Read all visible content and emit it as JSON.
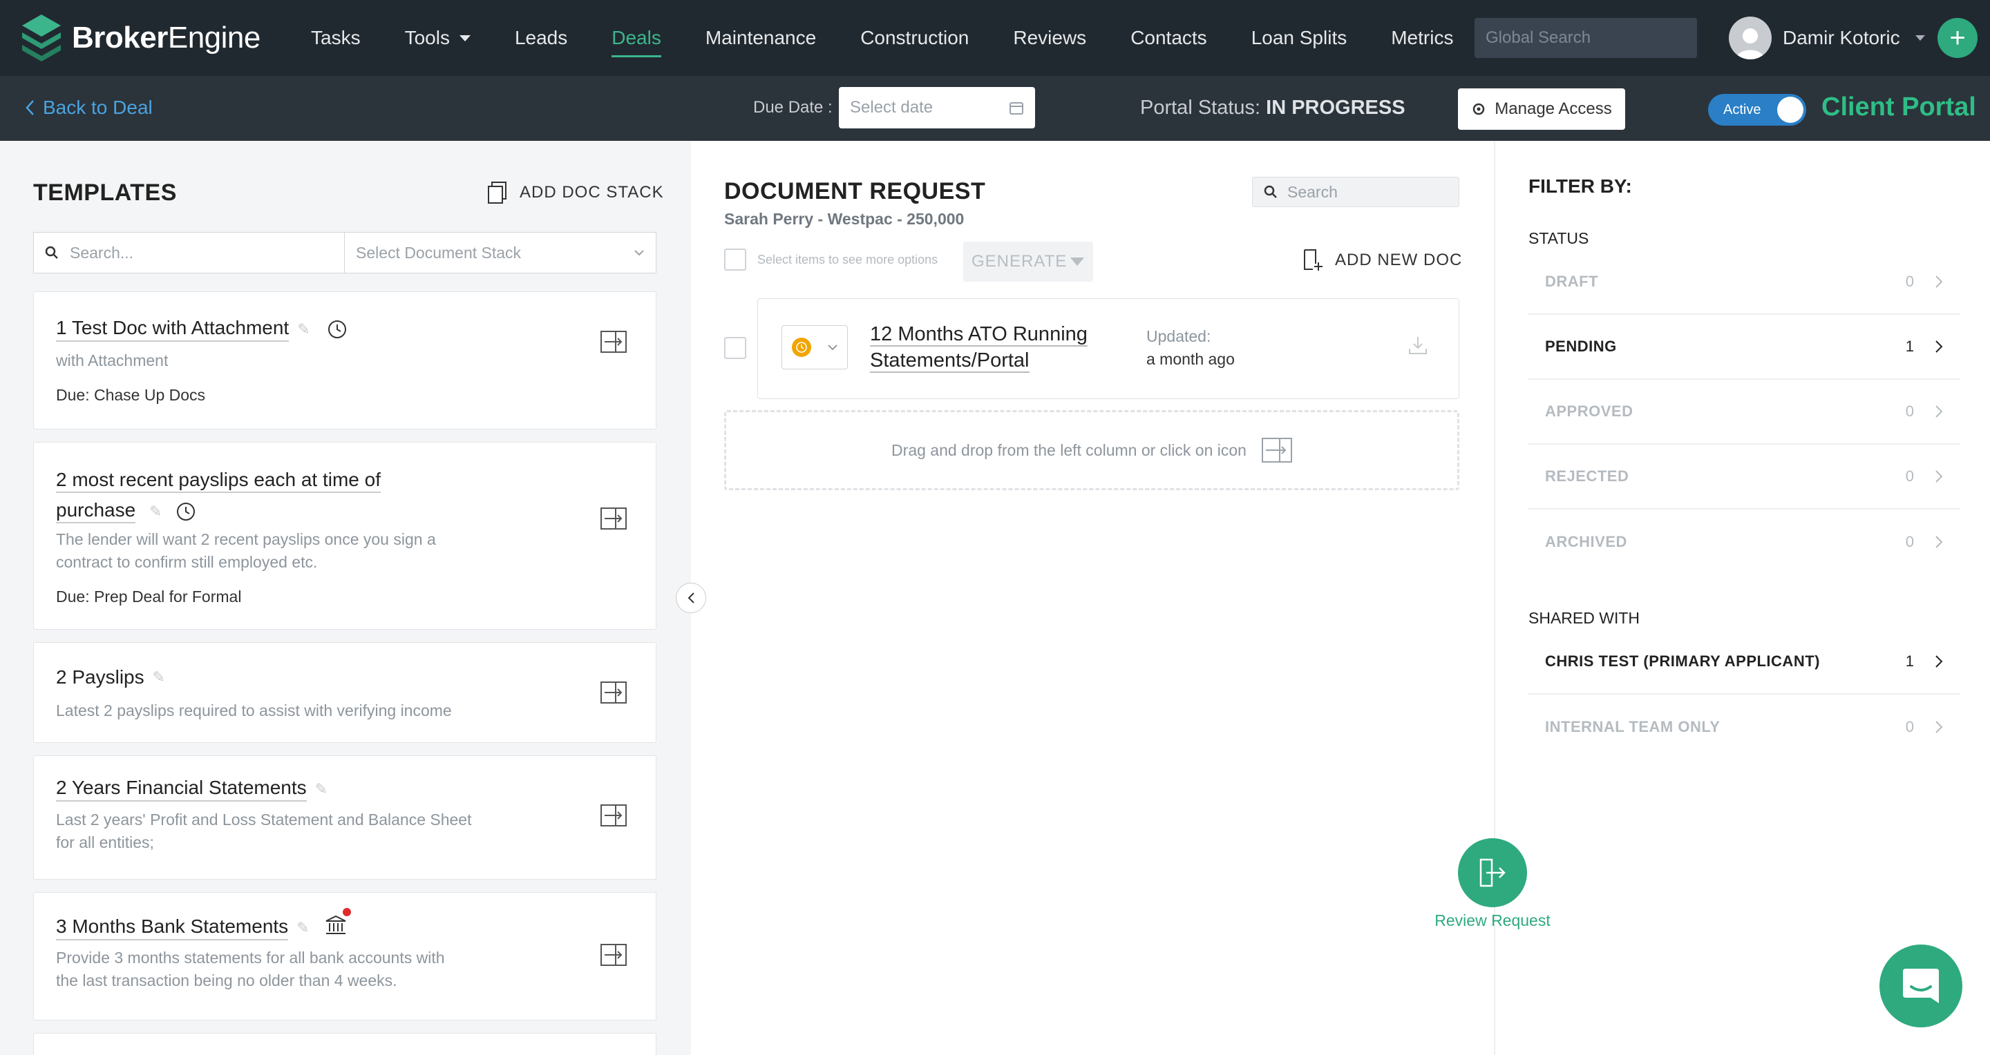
{
  "brand": {
    "name_bold": "Broker",
    "name_rest": "Engine",
    "accent": "#3db58c"
  },
  "nav": {
    "items": [
      {
        "label": "Tasks"
      },
      {
        "label": "Tools"
      },
      {
        "label": "Leads"
      },
      {
        "label": "Deals"
      },
      {
        "label": "Maintenance"
      },
      {
        "label": "Construction"
      },
      {
        "label": "Reviews"
      },
      {
        "label": "Contacts"
      },
      {
        "label": "Loan Splits"
      },
      {
        "label": "Metrics"
      }
    ],
    "active": "Deals",
    "search_placeholder": "Global Search",
    "user_name": "Damir Kotoric"
  },
  "subbar": {
    "back_label": "Back to Deal",
    "due_label": "Due Date :",
    "due_placeholder": "Select date",
    "portal_status_label": "Portal Status:",
    "portal_status_value": "IN PROGRESS",
    "manage_access_label": "Manage Access",
    "toggle_label": "Active",
    "toggle_on": true,
    "client_portal_label": "Client Portal"
  },
  "templates": {
    "title": "TEMPLATES",
    "add_stack_label": "ADD DOC STACK",
    "search_placeholder": "Search...",
    "stack_placeholder": "Select Document Stack",
    "cards": [
      {
        "title": "1 Test Doc with Attachment",
        "sub": "with Attachment",
        "due": "Due: Chase Up Docs"
      },
      {
        "title_line1": "2 most recent payslips each at time of",
        "title_line2": "purchase",
        "desc_line1": "The lender will want 2 recent payslips once you sign a",
        "desc_line2": "contract to confirm still employed etc.",
        "due": "Due: Prep Deal for Formal"
      },
      {
        "title": "2 Payslips",
        "desc_line1": "Latest 2 payslips required to assist with verifying income"
      },
      {
        "title": "2 Years Financial Statements",
        "desc_line1": "Last 2 years' Profit and Loss Statement and Balance Sheet",
        "desc_line2": "for all entities;"
      },
      {
        "title": "3 Months Bank Statements",
        "desc_line1": "Provide 3 months statements for all bank accounts with",
        "desc_line2": "the last transaction being no older than 4 weeks."
      }
    ]
  },
  "request": {
    "title": "DOCUMENT REQUEST",
    "subtitle": "Sarah Perry - Westpac - 250,000",
    "search_placeholder": "Search",
    "select_hint": "Select items to see more options",
    "generate_label": "GENERATE",
    "add_new_label": "ADD NEW DOC",
    "doc": {
      "title_line1": "12 Months ATO Running",
      "title_line2": "Statements/Portal",
      "updated_label": "Updated:",
      "updated_value": "a month ago",
      "status_color": "#f0a500"
    },
    "drop_hint": "Drag and drop from the left column or click on icon",
    "review_label": "Review Request"
  },
  "filters": {
    "title": "FILTER BY:",
    "status_title": "STATUS",
    "status": [
      {
        "label": "DRAFT",
        "count": "0"
      },
      {
        "label": "PENDING",
        "count": "1"
      },
      {
        "label": "APPROVED",
        "count": "0"
      },
      {
        "label": "REJECTED",
        "count": "0"
      },
      {
        "label": "ARCHIVED",
        "count": "0"
      }
    ],
    "shared_title": "SHARED WITH",
    "shared": [
      {
        "label": "CHRIS TEST (PRIMARY APPLICANT)",
        "count": "1"
      },
      {
        "label": "INTERNAL TEAM ONLY",
        "count": "0"
      }
    ]
  }
}
